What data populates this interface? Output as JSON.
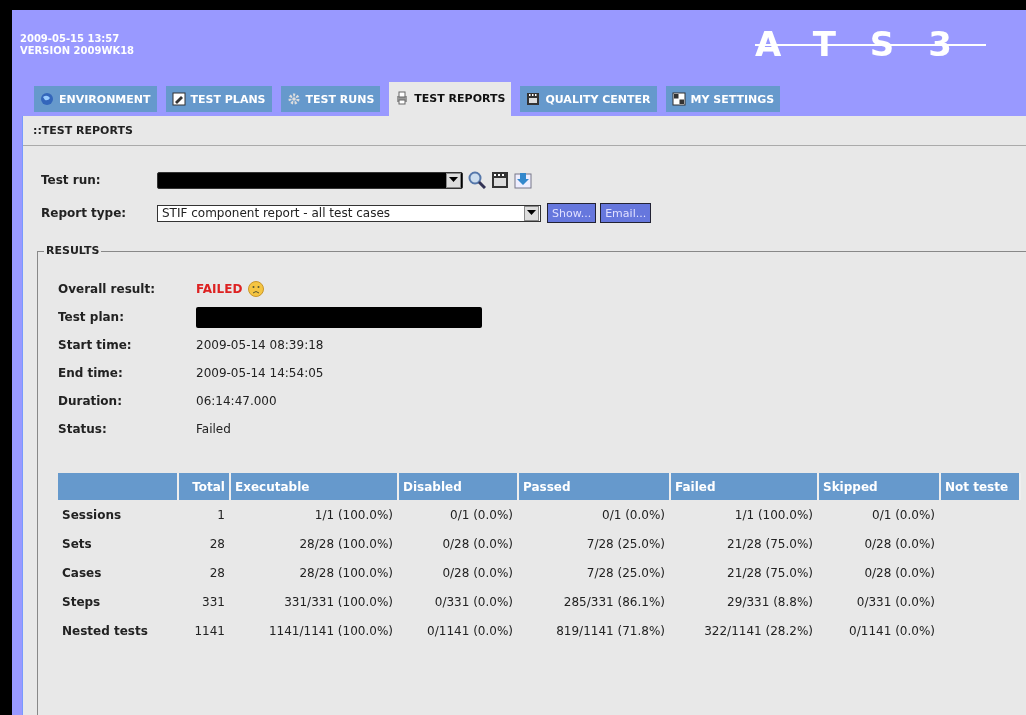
{
  "header": {
    "timestamp": "2009-05-15 13:57",
    "version": "VERSION 2009WK18",
    "logo": "ATS3"
  },
  "tabs": [
    {
      "label": "ENVIRONMENT",
      "selected": false
    },
    {
      "label": "TEST PLANS",
      "selected": false
    },
    {
      "label": "TEST RUNS",
      "selected": false
    },
    {
      "label": "TEST REPORTS",
      "selected": true
    },
    {
      "label": "QUALITY CENTER",
      "selected": false
    },
    {
      "label": "MY SETTINGS",
      "selected": false
    }
  ],
  "page_title": "::TEST REPORTS",
  "form": {
    "test_run_label": "Test run:",
    "report_type_label": "Report type:",
    "report_type_value": "STIF component report - all test cases",
    "buttons": [
      "Show...",
      "Email..."
    ]
  },
  "results": {
    "legend": "RESULTS",
    "fields": [
      {
        "label": "Overall result:",
        "value": "FAILED",
        "kind": "result"
      },
      {
        "label": "Test plan:",
        "kind": "redacted"
      },
      {
        "label": "Start time:",
        "value": "2009-05-14 08:39:18",
        "kind": "text"
      },
      {
        "label": "End time:",
        "value": "2009-05-14 14:54:05",
        "kind": "text"
      },
      {
        "label": "Duration:",
        "value": "06:14:47.000",
        "kind": "text"
      },
      {
        "label": "Status:",
        "value": "Failed",
        "kind": "text"
      }
    ],
    "table": {
      "columns": [
        "Total",
        "Executable",
        "Disabled",
        "Passed",
        "Failed",
        "Skipped",
        "Not teste"
      ],
      "rows": [
        {
          "label": "Sessions",
          "cells": [
            "1",
            "1/1 (100.0%)",
            "0/1 (0.0%)",
            "0/1 (0.0%)",
            "1/1 (100.0%)",
            "0/1 (0.0%)"
          ]
        },
        {
          "label": "Sets",
          "cells": [
            "28",
            "28/28 (100.0%)",
            "0/28 (0.0%)",
            "7/28 (25.0%)",
            "21/28 (75.0%)",
            "0/28 (0.0%)"
          ]
        },
        {
          "label": "Cases",
          "cells": [
            "28",
            "28/28 (100.0%)",
            "0/28 (0.0%)",
            "7/28 (25.0%)",
            "21/28 (75.0%)",
            "0/28 (0.0%)"
          ]
        },
        {
          "label": "Steps",
          "cells": [
            "331",
            "331/331 (100.0%)",
            "0/331 (0.0%)",
            "285/331 (86.1%)",
            "29/331 (8.8%)",
            "0/331 (0.0%)"
          ]
        },
        {
          "label": "Nested tests",
          "cells": [
            "1141",
            "1141/1141 (100.0%)",
            "0/1141 (0.0%)",
            "819/1141 (71.8%)",
            "322/1141 (28.2%)",
            "0/1141 (0.0%)"
          ]
        }
      ]
    }
  }
}
